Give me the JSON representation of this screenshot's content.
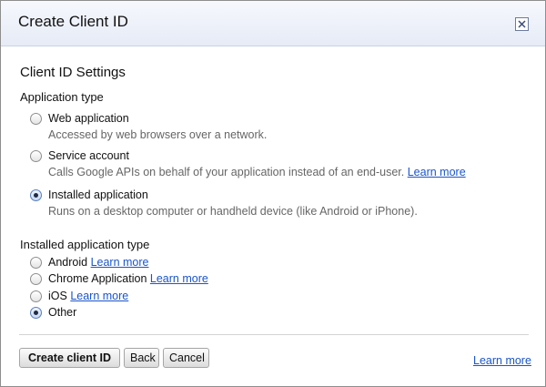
{
  "dialog": {
    "title": "Create Client ID",
    "close_icon": "close-icon"
  },
  "settings": {
    "heading": "Client ID Settings"
  },
  "application_type": {
    "label": "Application type",
    "options": [
      {
        "label": "Web application",
        "description": "Accessed by web browsers over a network.",
        "selected": false
      },
      {
        "label": "Service account",
        "description": "Calls Google APIs on behalf of your application instead of an end-user.",
        "link": "Learn more",
        "selected": false
      },
      {
        "label": "Installed application",
        "description": "Runs on a desktop computer or handheld device (like Android or iPhone).",
        "selected": true
      }
    ]
  },
  "installed_type": {
    "label": "Installed application type",
    "options": [
      {
        "label": "Android",
        "link": "Learn more",
        "selected": false
      },
      {
        "label": "Chrome Application",
        "link": "Learn more",
        "selected": false
      },
      {
        "label": "iOS",
        "link": "Learn more",
        "selected": false
      },
      {
        "label": "Other",
        "selected": true
      }
    ]
  },
  "buttons": {
    "create": "Create client ID",
    "back": "Back",
    "cancel": "Cancel"
  },
  "footer": {
    "link": "Learn more"
  },
  "colors": {
    "link": "#1a55cc",
    "titlebar": "#e6ebf6",
    "description": "#666666"
  }
}
